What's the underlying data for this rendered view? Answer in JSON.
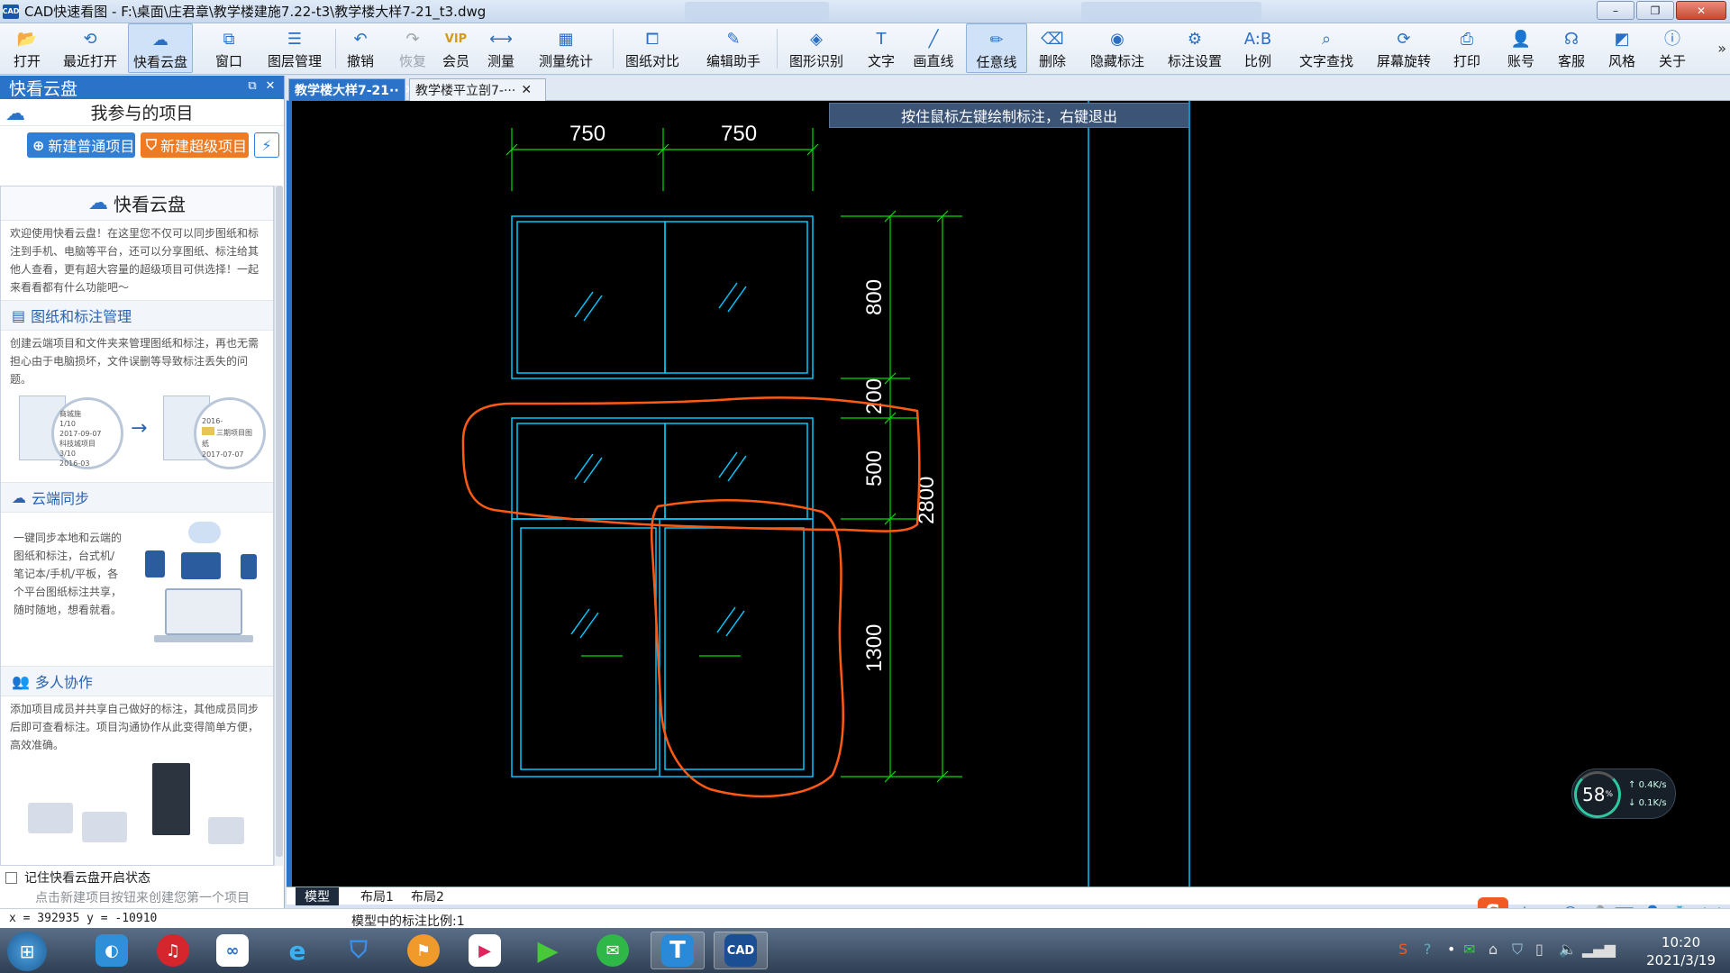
{
  "window": {
    "title": "CAD快速看图 - F:\\桌面\\庄君章\\教学楼建施7.22-t3\\教学楼大样7-21_t3.dwg",
    "logo_text": "CAD"
  },
  "toolbar": {
    "buttons": [
      {
        "label": "打开",
        "icon": "open-folder-icon",
        "glyph": "📂"
      },
      {
        "label": "最近打开",
        "icon": "clock-icon",
        "glyph": "⟲"
      },
      {
        "label": "快看云盘",
        "icon": "cloud-icon",
        "glyph": "☁"
      },
      {
        "label": "窗口",
        "icon": "window-icon",
        "glyph": "⧉"
      },
      {
        "label": "图层管理",
        "icon": "layers-icon",
        "glyph": "☰"
      },
      {
        "label": "撤销",
        "icon": "undo-icon",
        "glyph": "↶"
      },
      {
        "label": "恢复",
        "icon": "redo-icon",
        "glyph": "↷"
      },
      {
        "label": "会员",
        "icon": "vip-icon",
        "glyph": "VIP"
      },
      {
        "label": "测量",
        "icon": "measure-icon",
        "glyph": "⟷"
      },
      {
        "label": "测量统计",
        "icon": "measure-stats-icon",
        "glyph": "▦"
      },
      {
        "label": "图纸对比",
        "icon": "compare-icon",
        "glyph": "⧠"
      },
      {
        "label": "编辑助手",
        "icon": "edit-helper-icon",
        "glyph": "✎"
      },
      {
        "label": "图形识别",
        "icon": "shape-recognize-icon",
        "glyph": "◈"
      },
      {
        "label": "文字",
        "icon": "text-icon",
        "glyph": "T"
      },
      {
        "label": "画直线",
        "icon": "line-icon",
        "glyph": "╱"
      },
      {
        "label": "任意线",
        "icon": "freehand-icon",
        "glyph": "✏"
      },
      {
        "label": "删除",
        "icon": "eraser-icon",
        "glyph": "⌫"
      },
      {
        "label": "隐藏标注",
        "icon": "hide-markup-icon",
        "glyph": "◉"
      },
      {
        "label": "标注设置",
        "icon": "markup-settings-icon",
        "glyph": "⚙"
      },
      {
        "label": "比例",
        "icon": "scale-icon",
        "glyph": "A:B"
      },
      {
        "label": "文字查找",
        "icon": "text-search-icon",
        "glyph": "⌕"
      },
      {
        "label": "屏幕旋转",
        "icon": "rotate-screen-icon",
        "glyph": "⟳"
      },
      {
        "label": "打印",
        "icon": "print-icon",
        "glyph": "⎙"
      },
      {
        "label": "账号",
        "icon": "account-icon",
        "glyph": "👤"
      },
      {
        "label": "客服",
        "icon": "headset-icon",
        "glyph": "☊"
      },
      {
        "label": "风格",
        "icon": "style-icon",
        "glyph": "◩"
      },
      {
        "label": "关于",
        "icon": "info-icon",
        "glyph": "ⓘ"
      }
    ],
    "overflow": "»"
  },
  "left_panel": {
    "header": "快看云盘",
    "project_title": "我参与的项目",
    "new_normal_project": "新建普通项目",
    "new_super_project": "新建超级项目",
    "card_title": "快看云盘",
    "intro": "欢迎使用快看云盘！在这里您不仅可以同步图纸和标注到手机、电脑等平台，还可以分享图纸、标注给其他人查看，更有超大容量的超级项目可供选择！一起来看看都有什么功能吧～",
    "sections": [
      {
        "title": "图纸和标注管理",
        "text": "创建云端项目和文件夹来管理图纸和标注，再也无需担心由于电脑损坏，文件误删等导致标注丢失的问题。"
      },
      {
        "title": "云端同步",
        "text": "一键同步本地和云端的图纸和标注，台式机/笔记本/手机/平板，各个平台图纸标注共享，随时随地，想看就看。"
      },
      {
        "title": "多人协作",
        "text": "添加项目成员并共享自己做好的标注，其他成员同步后即可查看标注。项目沟通协作从此变得简单方便，高效准确。"
      }
    ],
    "illus_labels": {
      "a1": "商城施",
      "a2": "1/10",
      "a3": "2017-09-07",
      "a4": "科技城项目",
      "a5": "3/10",
      "a6": "2016-03",
      "b1": "三期项目图纸",
      "b2": "2017-07-07",
      "b3": "2016-"
    },
    "remember_label": "记住快看云盘开启状态",
    "footer_hint": "点击新建项目按钮来创建您第一个项目"
  },
  "doc_tabs": [
    {
      "label": "教学楼大样7-21··",
      "active": true
    },
    {
      "label": "教学楼平立剖7-···",
      "active": false
    }
  ],
  "canvas": {
    "hint": "按住鼠标左键绘制标注，右键退出",
    "dims_top": [
      "750",
      "750"
    ],
    "dims_right": [
      "800",
      "200",
      "500",
      "1300"
    ],
    "dim_total": "2800"
  },
  "layout_tabs": [
    "模型",
    "布局1",
    "布局2"
  ],
  "status": {
    "coords": "x = 392935  y = -10910",
    "scale": "模型中的标注比例:1"
  },
  "net_widget": {
    "percent": "58",
    "pct_sign": "%",
    "up": "0.4K/s",
    "down": "0.1K/s"
  },
  "clock": {
    "time": "10:20",
    "date": "2021/3/19"
  },
  "ime": {
    "logo": "S",
    "lang": "中",
    "punct": "•,"
  },
  "colors": {
    "accent": "#2a73c9",
    "cad_lines": "#00c8ff",
    "dim_lines": "#00e000",
    "markup": "#ff5a14"
  }
}
